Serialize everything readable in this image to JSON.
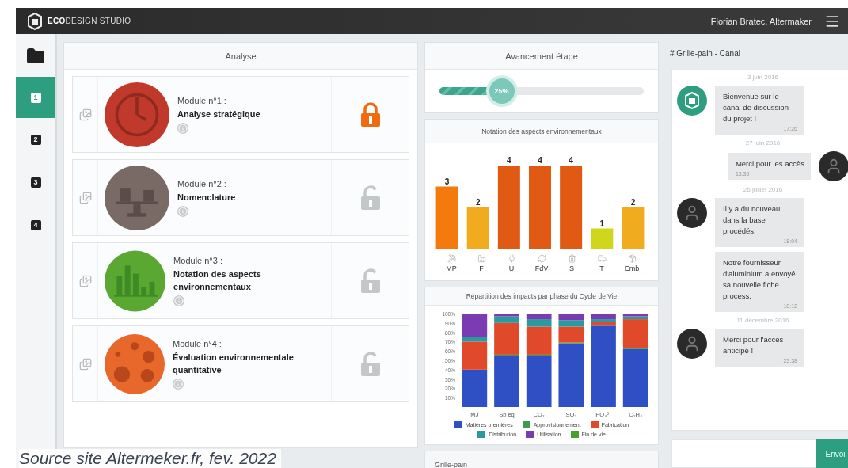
{
  "topbar": {
    "brand": "**ECO**DESIGN STUDIO",
    "user": "Florian Bratec, Altermaker"
  },
  "sidebar": {
    "items": [
      {
        "label": "1",
        "selected": true
      },
      {
        "label": "2",
        "selected": false
      },
      {
        "label": "3",
        "selected": false
      },
      {
        "label": "4",
        "selected": false
      }
    ]
  },
  "analyse": {
    "title": "Analyse",
    "modules": [
      {
        "kind": "clock",
        "number": "Module n°1 :",
        "title": "Analyse stratégique",
        "locked": true
      },
      {
        "kind": "scale",
        "number": "Module n°2 :",
        "title": "Nomenclature",
        "locked": false
      },
      {
        "kind": "bars",
        "number": "Module n°3 :",
        "title": "Notation des aspects environnementaux",
        "locked": false
      },
      {
        "kind": "network",
        "number": "Module n°4 :",
        "title": "Évaluation environnementale quantitative",
        "locked": false
      }
    ]
  },
  "progress": {
    "title": "Avancement étape",
    "level": 0.25,
    "reading": "25%"
  },
  "rating": {
    "chart_data": {
      "type": "bar",
      "title": "Notation des aspects environnementaux",
      "categories": [
        "MP",
        "F",
        "U",
        "FdV",
        "S",
        "T",
        "Emb"
      ],
      "values": [
        3,
        2,
        4,
        4,
        4,
        1,
        2
      ],
      "data_labels": true,
      "stacked": false
    }
  },
  "impacts": {
    "chart_data": {
      "type": "bar",
      "stacked": true,
      "legend": true,
      "title": "Répartition des impacts par phase du Cycle de Vie",
      "categories": [
        "MJ",
        "Sb eq",
        "CO₂",
        "SO₂",
        "PO₄³⁻",
        "C₂H₄"
      ],
      "ylim": [
        0,
        100
      ],
      "yticks": [
        {
          "value": 10,
          "label": "10%"
        },
        {
          "value": 20,
          "label": "20%"
        },
        {
          "value": 30,
          "label": "30%"
        },
        {
          "value": 40,
          "label": "40%"
        },
        {
          "value": 50,
          "label": "50%"
        },
        {
          "value": 60,
          "label": "60%"
        },
        {
          "value": 70,
          "label": "70%"
        },
        {
          "value": 80,
          "label": "80%"
        },
        {
          "value": 90,
          "label": "90%"
        },
        {
          "value": 100,
          "label": "100%"
        }
      ],
      "series": [
        {
          "name": "Matières premières",
          "color": "#2f4fc4",
          "values": [
            40,
            55,
            55,
            68,
            87,
            62
          ]
        },
        {
          "name": "Approvisionnement",
          "color": "#3f9a4e",
          "values": [
            0,
            1,
            1,
            1,
            0,
            1
          ]
        },
        {
          "name": "Fabrication",
          "color": "#e04a2a",
          "values": [
            30,
            34,
            30,
            17,
            4,
            31
          ]
        },
        {
          "name": "Distribution",
          "color": "#2a9aa0",
          "values": [
            5,
            7,
            8,
            7,
            3,
            3
          ]
        },
        {
          "name": "Utilisation",
          "color": "#7b3cb3",
          "values": [
            25,
            3,
            6,
            7,
            6,
            3
          ]
        },
        {
          "name": "Fin de vie",
          "color": "#4aa02c",
          "values": [
            0,
            0,
            0,
            0,
            0,
            0
          ]
        }
      ]
    }
  },
  "footer_tab": "Grille-pain",
  "chat": {
    "title": "# Grille-pain - Canal",
    "items": [
      {
        "kind": "date",
        "text": "3 juin 2016"
      },
      {
        "kind": "bot_message",
        "outgoing": false,
        "avatar": true,
        "text": "Bienvenue sur le canal de discussion du projet !",
        "time": "17:26"
      },
      {
        "kind": "date",
        "text": "27 juin 2016"
      },
      {
        "kind": "message",
        "outgoing": true,
        "avatar": true,
        "text": "Merci pour les accès",
        "time": "13:35"
      },
      {
        "kind": "date",
        "text": "26 juillet 2016"
      },
      {
        "kind": "message",
        "outgoing": false,
        "avatar": true,
        "text": "Il y a du nouveau dans la base procédés.",
        "time": "18:04"
      },
      {
        "kind": "message",
        "outgoing": false,
        "avatar": false,
        "text": "Notre fournisseur d'aluminium a envoyé sa nouvelle fiche process.",
        "time": "18:12"
      },
      {
        "kind": "date",
        "text": "11 décembre 2016"
      },
      {
        "kind": "message",
        "outgoing": false,
        "avatar": true,
        "text": "Merci pour l'accès anticipé !",
        "time": "23:38"
      }
    ],
    "send": "Envoi"
  },
  "caption": "Source site Altermeker.fr, fev. 2022"
}
